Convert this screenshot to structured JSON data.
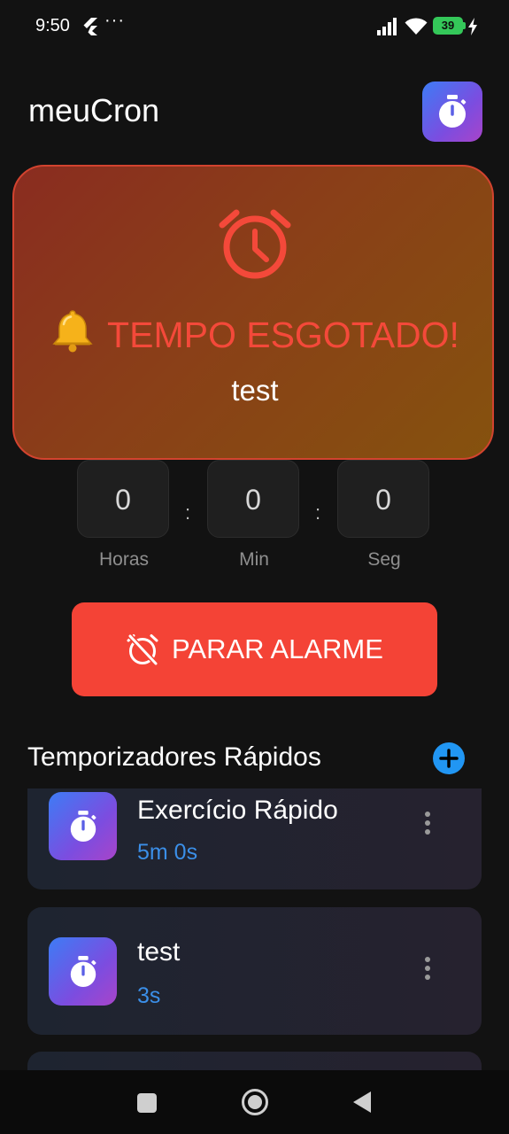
{
  "status_bar": {
    "time": "9:50",
    "dots": "···",
    "battery": "39",
    "icons": [
      "flutter-icon",
      "signal-icon",
      "wifi-icon",
      "battery-icon",
      "charging-bolt-icon"
    ]
  },
  "header": {
    "title": "meuCron",
    "icon": "stopwatch-icon"
  },
  "alarm": {
    "title": "TEMPO ESGOTADO!",
    "name": "test",
    "icons": [
      "alarm-clock-icon",
      "bell-icon"
    ]
  },
  "timer": {
    "hours": "0",
    "minutes": "0",
    "seconds": "0",
    "hours_label": "Horas",
    "minutes_label": "Min",
    "seconds_label": "Seg",
    "separator": ":"
  },
  "stop_button": {
    "label": "PARAR ALARME",
    "icon": "alarm-off-icon"
  },
  "quick_timers": {
    "title": "Temporizadores Rápidos",
    "add_icon": "plus-icon",
    "items": [
      {
        "name": "Exercício Rápido",
        "duration": "5m 0s"
      },
      {
        "name": "test",
        "duration": "3s"
      }
    ]
  },
  "colors": {
    "background": "#121212",
    "alarm_red": "#f44336",
    "accent_blue": "#2196f3",
    "duration_blue": "#3b8fe8",
    "battery_green": "#34c759"
  }
}
